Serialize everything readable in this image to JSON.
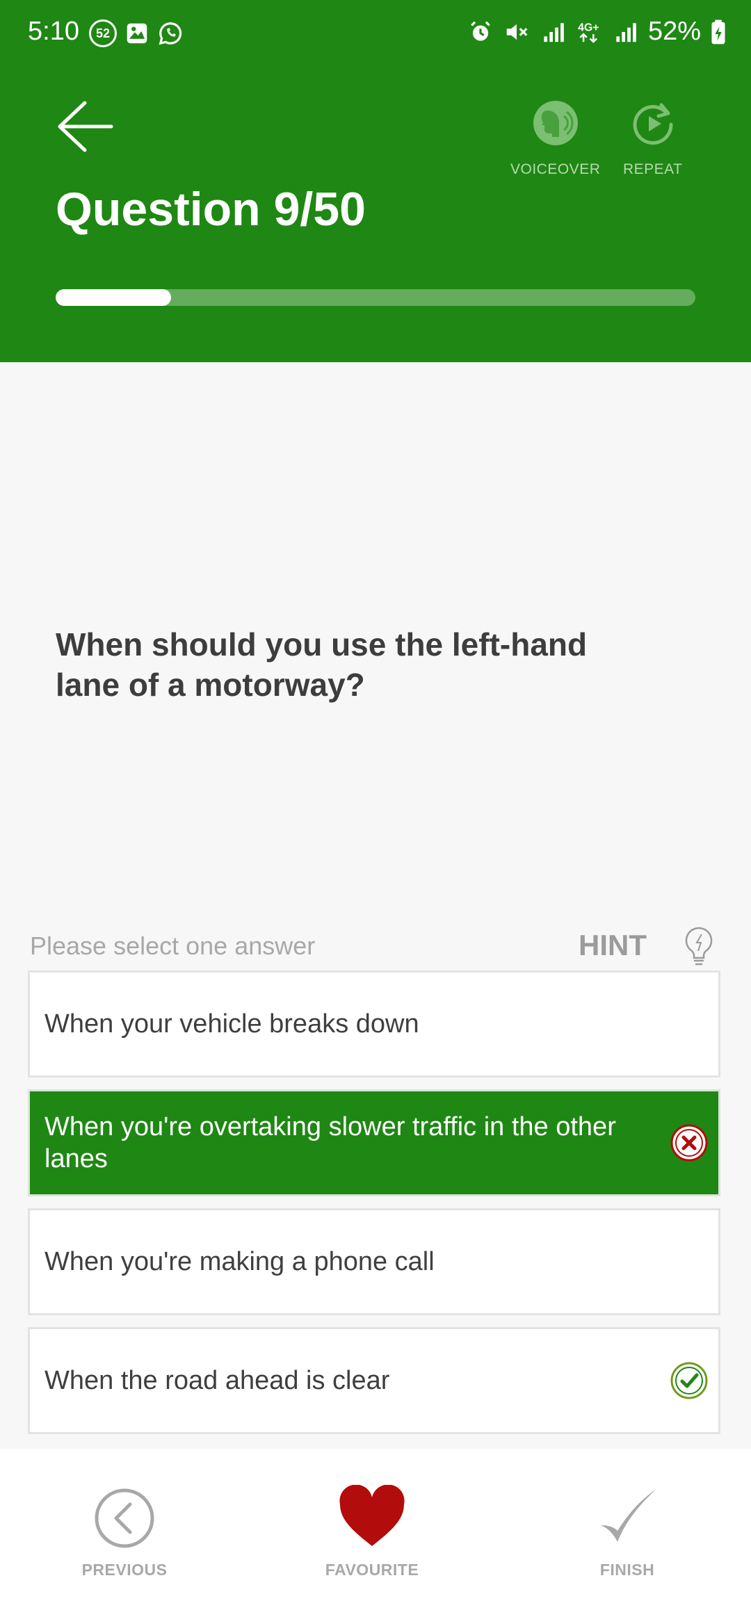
{
  "status_bar": {
    "time": "5:10",
    "notification_count": "52",
    "battery": "52%",
    "left_icons": [
      "notification-count-icon",
      "gallery-icon",
      "whatsapp-icon"
    ],
    "right_icons": [
      "alarm-icon",
      "mute-icon",
      "signal-icon",
      "4g-icon",
      "signal-icon"
    ]
  },
  "header": {
    "title": "Question 9/50",
    "voiceover_label": "VOICEOVER",
    "repeat_label": "REPEAT",
    "progress_fraction": 0.18,
    "colors": {
      "background": "#1f8714",
      "progress_track": "#66ac5d",
      "progress_fill": "#ffffff"
    }
  },
  "question": {
    "text": "When should you use the left-hand lane of a motorway?"
  },
  "answers_section": {
    "instruction": "Please select one answer",
    "hint_label": "HINT"
  },
  "answers": [
    {
      "text": "When your vehicle breaks down",
      "selected": false,
      "mark": ""
    },
    {
      "text": "When you're overtaking slower traffic in the other lanes",
      "selected": true,
      "mark": "wrong"
    },
    {
      "text": "When you're making a phone call",
      "selected": false,
      "mark": ""
    },
    {
      "text": "When the road ahead is clear",
      "selected": false,
      "mark": "correct"
    }
  ],
  "bottom_nav": {
    "previous_label": "PREVIOUS",
    "favourite_label": "FAVOURITE",
    "finish_label": "FINISH",
    "favourite_color": "#b30c0c"
  }
}
